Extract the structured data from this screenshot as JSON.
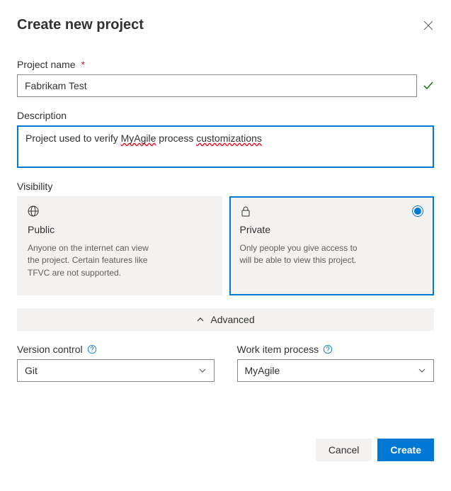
{
  "dialog": {
    "title": "Create new project"
  },
  "fields": {
    "name": {
      "label": "Project name",
      "value": "Fabrikam Test",
      "required_marker": "*"
    },
    "description": {
      "label": "Description",
      "value_parts": {
        "pre": "Project used to verify ",
        "err1": "MyAgile",
        "mid": " process ",
        "err2": "customizations"
      }
    }
  },
  "visibility": {
    "label": "Visibility",
    "options": [
      {
        "key": "public",
        "title": "Public",
        "desc": "Anyone on the internet can view the project. Certain features like TFVC are not supported.",
        "selected": false
      },
      {
        "key": "private",
        "title": "Private",
        "desc": "Only people you give access to will be able to view this project.",
        "selected": true
      }
    ]
  },
  "advanced": {
    "toggle_label": "Advanced",
    "version_control": {
      "label": "Version control",
      "value": "Git"
    },
    "work_item_process": {
      "label": "Work item process",
      "value": "MyAgile"
    }
  },
  "buttons": {
    "cancel": "Cancel",
    "create": "Create"
  }
}
